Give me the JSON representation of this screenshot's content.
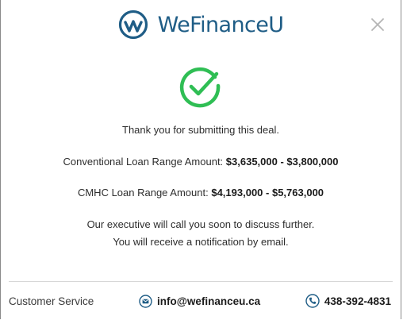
{
  "brand": {
    "name": "WeFinanceU",
    "color": "#1f5d86"
  },
  "icons": {
    "logo": "wefinanceu-logo-icon",
    "close": "close-icon",
    "success": "check-circle-icon",
    "email": "mail-icon",
    "phone": "phone-icon"
  },
  "colors": {
    "success": "#2fbe54",
    "close": "#b5b5b5"
  },
  "message": {
    "thank_you": "Thank you for submitting this deal.",
    "conventional_label": "Conventional Loan Range Amount: ",
    "conventional_range": "$3,635,000 - $3,800,000",
    "cmhc_label": "CMHC Loan Range Amount: ",
    "cmhc_range": "$4,193,000 - $5,763,000",
    "executive_call": "Our executive will call you soon to discuss further.",
    "notification": "You will receive a notification by email."
  },
  "footer": {
    "customer_service": "Customer Service",
    "email": "info@wefinanceu.ca",
    "phone": "438-392-4831"
  }
}
